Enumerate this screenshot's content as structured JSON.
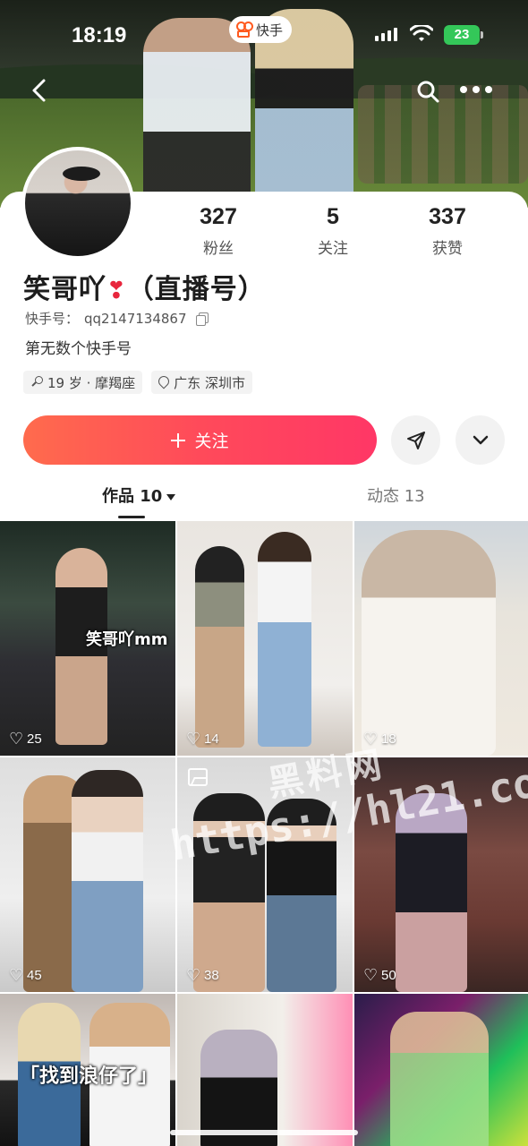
{
  "status_bar": {
    "time": "18:19",
    "app_name": "快手",
    "battery": "23"
  },
  "profile": {
    "username": "笑哥吖",
    "username_suffix": "（直播号）",
    "kuaishou_id_label": "快手号：",
    "kuaishou_id": "qq2147134867",
    "bio": "第无数个快手号",
    "tags": [
      {
        "icon": "female-icon",
        "text": "19 岁 · 摩羯座"
      },
      {
        "icon": "location-pin-icon",
        "text": "广东 深圳市"
      }
    ],
    "stats": [
      {
        "value": "327",
        "label": "粉丝"
      },
      {
        "value": "5",
        "label": "关注"
      },
      {
        "value": "337",
        "label": "获赞"
      }
    ]
  },
  "actions": {
    "follow_label": "关注"
  },
  "tabs": {
    "works": "作品 10",
    "moments": "动态 13"
  },
  "grid": [
    {
      "likes": "25",
      "overlay": "笑哥吖mm"
    },
    {
      "likes": "14"
    },
    {
      "likes": "18"
    },
    {
      "likes": "45"
    },
    {
      "likes": "38",
      "multi_image": true
    },
    {
      "likes": "50"
    },
    {
      "overlay": "「找到浪仔了」"
    },
    {},
    {}
  ],
  "watermark": {
    "line1": "黑料网",
    "line2": "https://hl21.co"
  },
  "colors": {
    "follow_gradient_start": "#ff6b4d",
    "follow_gradient_end": "#ff3766",
    "battery_green": "#34c759",
    "heart_red": "#e8263d"
  }
}
